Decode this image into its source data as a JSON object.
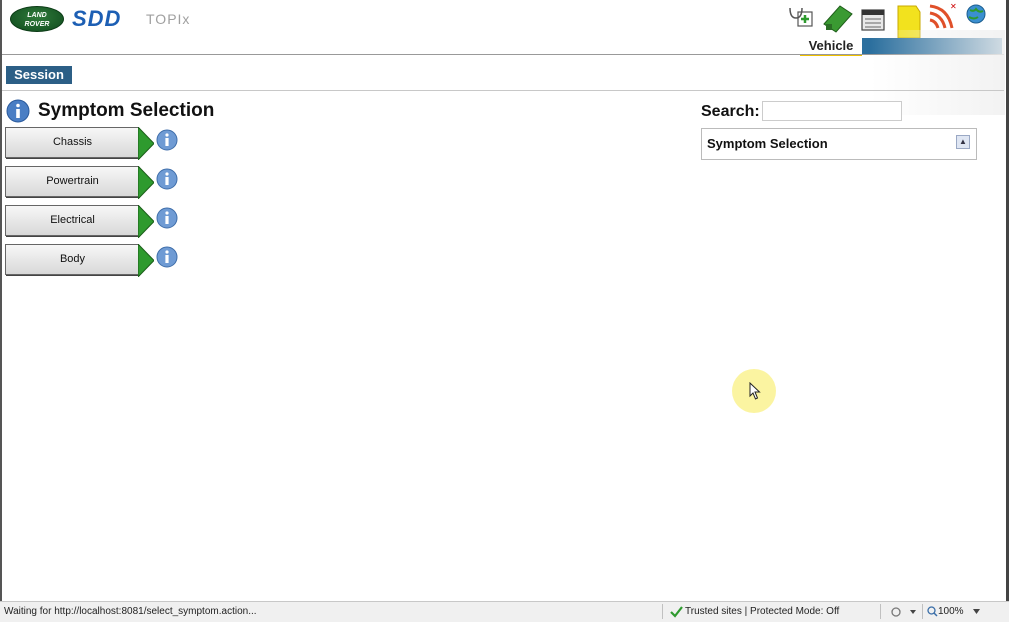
{
  "header": {
    "landrover_logo_text": "LAND ROVER",
    "sdd_logo_text": "SDD",
    "topix_text": "TOPIx",
    "vehicle_tab_label": "Vehicle",
    "tool_icons": [
      "stethoscope-icon",
      "green-tag-icon",
      "calendar-icon",
      "yellow-tag-icon",
      "wireless-icon",
      "globe-icon"
    ]
  },
  "session": {
    "label": "Session"
  },
  "main": {
    "title": "Symptom Selection",
    "categories": [
      {
        "label": "Chassis"
      },
      {
        "label": "Powertrain"
      },
      {
        "label": "Electrical"
      },
      {
        "label": "Body"
      }
    ]
  },
  "search": {
    "label": "Search:",
    "value": ""
  },
  "symptom_box": {
    "label": "Symptom Selection"
  },
  "status_bar": {
    "text": "Waiting for http://localhost:8081/select_symptom.action...",
    "zone": "Trusted sites | Protected Mode: Off",
    "zoom": "100%"
  },
  "colors": {
    "accent_blue": "#2c5f86",
    "arrow_green": "#2e9a2e",
    "info_blue": "#4a7ec4"
  }
}
